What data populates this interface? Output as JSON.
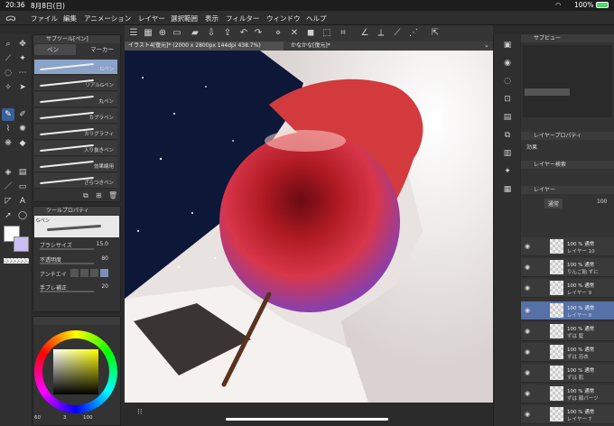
{
  "status": {
    "time": "20:36",
    "date": "8月8日(日)",
    "battery": "100%"
  },
  "menu": [
    "ファイル",
    "編集",
    "アニメーション",
    "レイヤー",
    "選択範囲",
    "表示",
    "フィルター",
    "ウィンドウ",
    "ヘルプ"
  ],
  "tabs": {
    "active": "イラスト4[復元]* (2000 x 2800px 144dpi 438.7%)",
    "second": "かなかな[復元]*"
  },
  "subtool": {
    "header": "サブツール[ペン]",
    "tab_pen": "ペン",
    "tab_marker": "マーカー",
    "brushes": [
      "Gペン",
      "リアルGペン",
      "丸ペン",
      "カブラペン",
      "カリグラフィ",
      "入り抜きペン",
      "効果線用",
      "ざらつきペン"
    ]
  },
  "toolprop": {
    "header": "ツールプロパティ",
    "brush_name": "Gペン",
    "size_label": "ブラシサイズ",
    "size_value": "15.0",
    "opacity_label": "不透明度",
    "opacity_value": "80",
    "aa_label": "アンチエイ",
    "stab_label": "手ブレ補正",
    "stab_value": "20"
  },
  "color": {
    "fg": "#ffffff",
    "bg": "#c9bff2",
    "h_value": "60",
    "s_value": "3",
    "v_value": "100"
  },
  "rightpanel": {
    "subview_header": "サブビュー",
    "layerprop_header": "レイヤープロパティ",
    "effect_label": "効果",
    "layersearch_header": "レイヤー検索",
    "layer_header": "レイヤー",
    "blend_mode": "通常",
    "opacity": "100"
  },
  "layers": [
    {
      "pct": "100 %",
      "mode": "通常",
      "name": "レイヤー 10",
      "selected": false
    },
    {
      "pct": "100 %",
      "mode": "通常",
      "name": "りんご飴 ずに",
      "selected": false
    },
    {
      "pct": "100 %",
      "mode": "通常",
      "name": "レイヤー 9",
      "selected": false
    },
    {
      "pct": "100 %",
      "mode": "通常",
      "name": "レイヤー 8",
      "selected": true
    },
    {
      "pct": "100 %",
      "mode": "通常",
      "name": "ずは 髪",
      "selected": false
    },
    {
      "pct": "100 %",
      "mode": "通常",
      "name": "ずは 浴衣",
      "selected": false
    },
    {
      "pct": "100 %",
      "mode": "通常",
      "name": "ずは 肌",
      "selected": false
    },
    {
      "pct": "100 %",
      "mode": "通常",
      "name": "ずは 顔パーツ",
      "selected": false
    },
    {
      "pct": "100 %",
      "mode": "通常",
      "name": "レイヤー 7",
      "selected": false
    }
  ]
}
